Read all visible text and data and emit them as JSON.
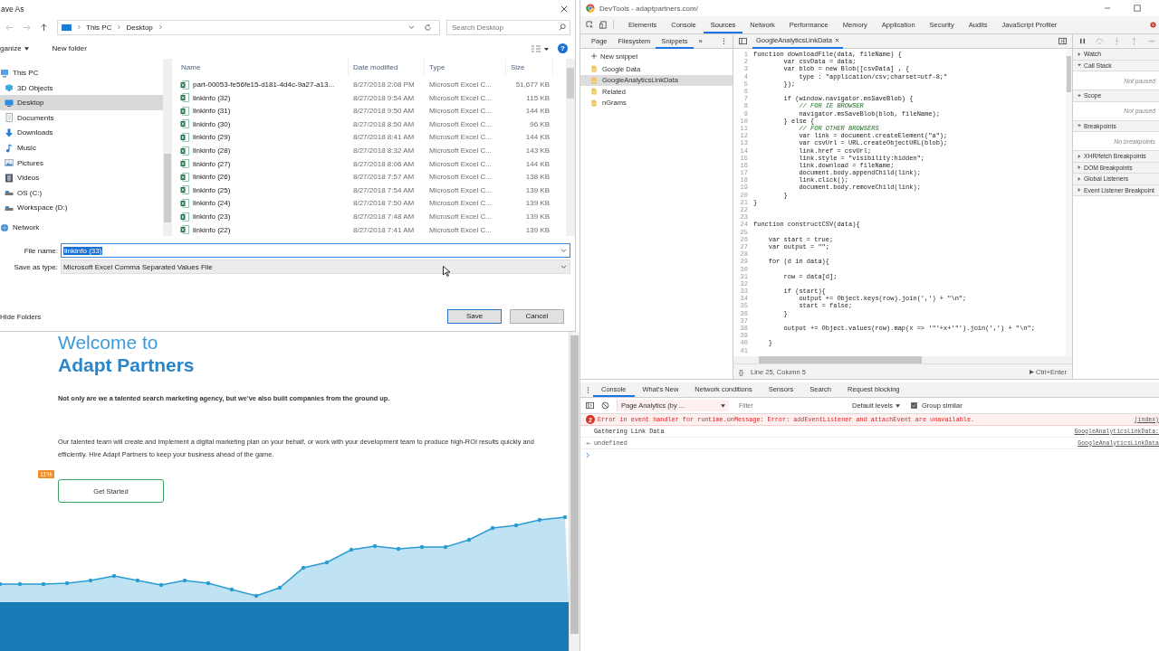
{
  "save_dialog": {
    "title": "ave As",
    "breadcrumb": [
      "This PC",
      "Desktop"
    ],
    "search": {
      "placeholder": "Search Desktop"
    },
    "toolbar": {
      "organize": "ganize",
      "new_folder": "New folder",
      "help": "?"
    },
    "nav_items": [
      {
        "label": "This PC",
        "kind": "pc",
        "selected": false
      },
      {
        "label": "3D Objects",
        "kind": "cube",
        "selected": false
      },
      {
        "label": "Desktop",
        "kind": "desktop",
        "selected": true
      },
      {
        "label": "Documents",
        "kind": "document",
        "selected": false
      },
      {
        "label": "Downloads",
        "kind": "download",
        "selected": false
      },
      {
        "label": "Music",
        "kind": "music",
        "selected": false
      },
      {
        "label": "Pictures",
        "kind": "picture",
        "selected": false
      },
      {
        "label": "Videos",
        "kind": "video",
        "selected": false
      },
      {
        "label": "OS (C:)",
        "kind": "drive",
        "selected": false
      },
      {
        "label": "Workspace (D:)",
        "kind": "drive",
        "selected": false
      },
      {
        "label": "Network",
        "kind": "network",
        "selected": false
      }
    ],
    "columns": [
      "Name",
      "Date modified",
      "Type",
      "Size"
    ],
    "files": [
      {
        "name": "part-00053-fe56fe15-d181-4d4c-9a27-a13...",
        "date": "8/27/2018 2:08 PM",
        "type": "Microsoft Excel C...",
        "size": "51,677 KB"
      },
      {
        "name": "linkinfo (32)",
        "date": "8/27/2018 9:54 AM",
        "type": "Microsoft Excel C...",
        "size": "115 KB"
      },
      {
        "name": "linkinfo (31)",
        "date": "8/27/2018 9:50 AM",
        "type": "Microsoft Excel C...",
        "size": "144 KB"
      },
      {
        "name": "linkinfo (30)",
        "date": "8/27/2018 8:50 AM",
        "type": "Microsoft Excel C...",
        "size": "96 KB"
      },
      {
        "name": "linkinfo (29)",
        "date": "8/27/2018 8:41 AM",
        "type": "Microsoft Excel C...",
        "size": "144 KB"
      },
      {
        "name": "linkinfo (28)",
        "date": "8/27/2018 8:32 AM",
        "type": "Microsoft Excel C...",
        "size": "143 KB"
      },
      {
        "name": "linkinfo (27)",
        "date": "8/27/2018 8:06 AM",
        "type": "Microsoft Excel C...",
        "size": "144 KB"
      },
      {
        "name": "linkinfo (26)",
        "date": "8/27/2018 7:57 AM",
        "type": "Microsoft Excel C...",
        "size": "138 KB"
      },
      {
        "name": "linkinfo (25)",
        "date": "8/27/2018 7:54 AM",
        "type": "Microsoft Excel C...",
        "size": "139 KB"
      },
      {
        "name": "linkinfo (24)",
        "date": "8/27/2018 7:50 AM",
        "type": "Microsoft Excel C...",
        "size": "139 KB"
      },
      {
        "name": "linkinfo (23)",
        "date": "8/27/2018 7:48 AM",
        "type": "Microsoft Excel C...",
        "size": "139 KB"
      },
      {
        "name": "linkinfo (22)",
        "date": "8/27/2018 7:41 AM",
        "type": "Microsoft Excel C...",
        "size": "139 KB"
      }
    ],
    "file_name": {
      "label": "File name:",
      "value": "linkinfo (33)"
    },
    "save_type": {
      "label": "Save as type:",
      "value": "Microsoft Excel Comma Separated Values File"
    },
    "hide_folders": "Hide Folders",
    "buttons": [
      "Save",
      "Cancel"
    ]
  },
  "webpage": {
    "heading_light": "Welcome to",
    "heading_bold": "Adapt Partners",
    "intro": "Not only are we a talented search marketing agency, but we've also built companies from the ground up.",
    "body": "Our talented team will create and implement a digital marketing plan on your behalf, or work with your development team to produce high-ROI results quickly and efficiently. Hire Adapt Partners to keep your business ahead of the game.",
    "badge": "11%",
    "cta": "Get Started"
  },
  "devtools": {
    "title": "DevTools - adaptpartners.com/",
    "tabs": [
      {
        "label": "Elements",
        "selected": false
      },
      {
        "label": "Console",
        "selected": false
      },
      {
        "label": "Sources",
        "selected": true
      },
      {
        "label": "Network",
        "selected": false
      },
      {
        "label": "Performance",
        "selected": false
      },
      {
        "label": "Memory",
        "selected": false
      },
      {
        "label": "Application",
        "selected": false
      },
      {
        "label": "Security",
        "selected": false
      },
      {
        "label": "Audits",
        "selected": false
      },
      {
        "label": "JavaScript Profiler",
        "selected": false
      }
    ],
    "navigator_tabs": [
      {
        "label": "Page",
        "selected": false
      },
      {
        "label": "Filesystem",
        "selected": false
      },
      {
        "label": "Snippets",
        "selected": true
      }
    ],
    "more": "»",
    "new_snippet": "New snippet",
    "snippets": [
      {
        "label": "Google Data",
        "selected": false
      },
      {
        "label": "GoogleAnalyticsLinkData",
        "selected": true
      },
      {
        "label": "Related",
        "selected": false
      },
      {
        "label": "nGrams",
        "selected": false
      }
    ],
    "editor_tab": "GoogleAnalyticsLinkData",
    "code": [
      {
        "number": "1",
        "kind": "code",
        "text": "function downloadFile(data, fileName) {"
      },
      {
        "number": "2",
        "kind": "code",
        "text": "        var csvData = data;"
      },
      {
        "number": "3",
        "kind": "code",
        "text": "        var blob = new Blob([csvData] , {"
      },
      {
        "number": "4",
        "kind": "code",
        "text": "            type : \"application/csv;charset=utf-8;\""
      },
      {
        "number": "5",
        "kind": "code",
        "text": "        });"
      },
      {
        "number": "6"
      },
      {
        "number": "7",
        "kind": "code",
        "text": "        if (window.navigator.msSaveBlob) {"
      },
      {
        "number": "8",
        "kind": "comment",
        "text": "            // FOR IE BROWSER"
      },
      {
        "number": "9",
        "kind": "code",
        "text": "            navigator.msSaveBlob(blob, fileName);"
      },
      {
        "number": "10",
        "kind": "code",
        "text": "        } else {"
      },
      {
        "number": "11",
        "kind": "comment",
        "text": "            // FOR OTHER BROWSERS"
      },
      {
        "number": "12",
        "kind": "code",
        "text": "            var link = document.createElement(\"a\");"
      },
      {
        "number": "13",
        "kind": "code",
        "text": "            var csvUrl = URL.createObjectURL(blob);"
      },
      {
        "number": "14",
        "kind": "code",
        "text": "            link.href = csvUrl;"
      },
      {
        "number": "15",
        "kind": "code",
        "text": "            link.style = \"visibility:hidden\";"
      },
      {
        "number": "16",
        "kind": "code",
        "text": "            link.download = fileName;"
      },
      {
        "number": "17",
        "kind": "code",
        "text": "            document.body.appendChild(link);"
      },
      {
        "number": "18",
        "kind": "code",
        "text": "            link.click();"
      },
      {
        "number": "19",
        "kind": "code",
        "text": "            document.body.removeChild(link);"
      },
      {
        "number": "20",
        "kind": "code",
        "text": "        }"
      },
      {
        "number": "21",
        "kind": "code",
        "text": "}"
      },
      {
        "number": "22"
      },
      {
        "number": "23"
      },
      {
        "number": "24",
        "kind": "code",
        "text": "function constructCSV(data){"
      },
      {
        "number": "25"
      },
      {
        "number": "26",
        "kind": "code",
        "text": "    var start = true;"
      },
      {
        "number": "27",
        "kind": "code",
        "text": "    var output = \"\";"
      },
      {
        "number": "28"
      },
      {
        "number": "29",
        "kind": "code",
        "text": "    for (d in data){"
      },
      {
        "number": "30"
      },
      {
        "number": "31",
        "kind": "code",
        "text": "        row = data[d];"
      },
      {
        "number": "32"
      },
      {
        "number": "33",
        "kind": "code",
        "text": "        if (start){"
      },
      {
        "number": "34",
        "kind": "code",
        "text": "            output += Object.keys(row).join(',') + \"\\n\";"
      },
      {
        "number": "35",
        "kind": "code",
        "text": "            start = false;"
      },
      {
        "number": "36",
        "kind": "code",
        "text": "        }"
      },
      {
        "number": "37"
      },
      {
        "number": "38",
        "kind": "code",
        "text": "        output += Object.values(row).map(x => '\"'+x+'\"').join(',') + \"\\n\";"
      },
      {
        "number": "39"
      },
      {
        "number": "40",
        "kind": "code",
        "text": "    }"
      },
      {
        "number": "41"
      }
    ],
    "status": {
      "braces": "{}",
      "position": "Line 25, Column 5",
      "run": "Ctrl+Enter"
    },
    "debugger_sections": [
      {
        "label": "Watch",
        "expanded": false
      },
      {
        "label": "Call Stack",
        "expanded": true,
        "body": "Not paused"
      },
      {
        "label": "Scope",
        "expanded": true,
        "body": "Not paused"
      },
      {
        "label": "Breakpoints",
        "expanded": true,
        "body": "No breakpoints"
      },
      {
        "label": "XHR/fetch Breakpoints",
        "expanded": false
      },
      {
        "label": "DOM Breakpoints",
        "expanded": false
      },
      {
        "label": "Global Listeners",
        "expanded": false
      },
      {
        "label": "Event Listener Breakpoint",
        "expanded": false
      }
    ],
    "drawer_tabs": [
      {
        "label": "Console",
        "selected": true
      },
      {
        "label": "What's New",
        "selected": false
      },
      {
        "label": "Network conditions",
        "selected": false
      },
      {
        "label": "Sensors",
        "selected": false
      },
      {
        "label": "Search",
        "selected": false
      },
      {
        "label": "Request blocking",
        "selected": false
      }
    ],
    "console_toolbar": {
      "context": "Page Analytics (by ...",
      "filter": {
        "placeholder": "Filter"
      },
      "levels": "Default levels",
      "group_similar": {
        "label": "Group similar",
        "checked": true
      }
    },
    "messages": [
      {
        "kind": "error",
        "count": "2",
        "text": "Error in event handler for runtime.onMessage: Error: addEventListener and attachEvent are unavailable.",
        "source": "(index)"
      },
      {
        "kind": "log",
        "text": "Gathering Link Data",
        "source": "GoogleAnalyticsLinkData:"
      },
      {
        "kind": "result",
        "text": "undefined",
        "source": "GoogleAnalyticsLinkData"
      }
    ]
  }
}
